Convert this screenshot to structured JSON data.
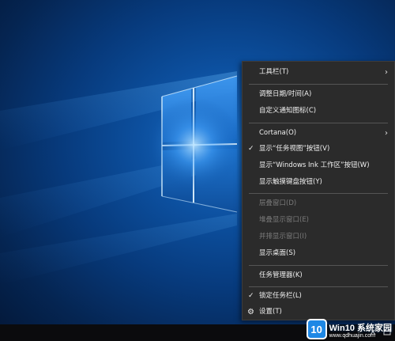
{
  "menu": {
    "items": [
      {
        "label": "工具栏(T)",
        "submenu": true
      },
      {
        "label": "调整日期/时间(A)"
      },
      {
        "label": "自定义通知图标(C)"
      },
      {
        "label": "Cortana(O)",
        "submenu": true
      },
      {
        "label": "显示“任务视图”按钮(V)",
        "checked": true
      },
      {
        "label": "显示“Windows Ink 工作区”按钮(W)"
      },
      {
        "label": "显示触摸键盘按钮(Y)"
      },
      {
        "label": "层叠窗口(D)",
        "disabled": true
      },
      {
        "label": "堆叠显示窗口(E)",
        "disabled": true
      },
      {
        "label": "并排显示窗口(I)",
        "disabled": true
      },
      {
        "label": "显示桌面(S)"
      },
      {
        "label": "任务管理器(K)"
      },
      {
        "label": "锁定任务栏(L)",
        "checked": true
      },
      {
        "label": "设置(T)",
        "icon": "gear-icon"
      }
    ],
    "submenu_arrow": "›",
    "check_mark": "✓",
    "gear_glyph": "⚙"
  },
  "watermark": {
    "logo_text": "10",
    "title": "Win10 系统家园",
    "url": "www.qdhuajin.com"
  },
  "colors": {
    "menu_bg": "#2b2b2b",
    "menu_text": "#f0f0f0",
    "disabled_text": "#7b7b7b",
    "taskbar": "#0b0b0d",
    "desktop_blue": "#0c4f9e"
  }
}
